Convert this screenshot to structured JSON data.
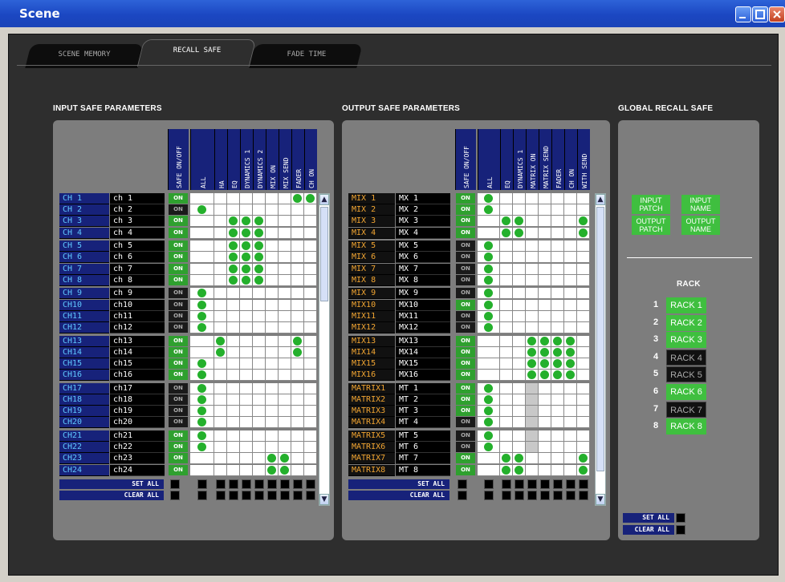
{
  "window": {
    "title": "Scene"
  },
  "tabs": [
    "SCENE MEMORY",
    "RECALL SAFE",
    "FADE TIME"
  ],
  "active_tab": 1,
  "sections": {
    "input": "INPUT SAFE PARAMETERS",
    "output": "OUTPUT SAFE PARAMETERS",
    "global": "GLOBAL RECALL SAFE"
  },
  "input_columns": [
    "SAFE ON/OFF",
    "ALL",
    "HA",
    "EQ",
    "DYNAMICS 1",
    "DYNAMICS 2",
    "MIX ON",
    "MIX SEND",
    "FADER",
    "CH ON"
  ],
  "input_rows": [
    {
      "label": "CH 1",
      "name": "ch 1",
      "on": true,
      "dots": [
        0,
        0,
        0,
        0,
        0,
        0,
        0,
        1,
        1
      ]
    },
    {
      "label": "CH 2",
      "name": "ch 2",
      "on": false,
      "dots": [
        1,
        0,
        0,
        0,
        0,
        0,
        0,
        0,
        0
      ]
    },
    {
      "label": "CH 3",
      "name": "ch 3",
      "on": true,
      "dots": [
        0,
        0,
        1,
        1,
        1,
        0,
        0,
        0,
        0
      ]
    },
    {
      "label": "CH 4",
      "name": "ch 4",
      "on": true,
      "dots": [
        0,
        0,
        1,
        1,
        1,
        0,
        0,
        0,
        0
      ]
    },
    {
      "label": "CH 5",
      "name": "ch 5",
      "on": true,
      "dots": [
        0,
        0,
        1,
        1,
        1,
        0,
        0,
        0,
        0
      ]
    },
    {
      "label": "CH 6",
      "name": "ch 6",
      "on": true,
      "dots": [
        0,
        0,
        1,
        1,
        1,
        0,
        0,
        0,
        0
      ]
    },
    {
      "label": "CH 7",
      "name": "ch 7",
      "on": true,
      "dots": [
        0,
        0,
        1,
        1,
        1,
        0,
        0,
        0,
        0
      ]
    },
    {
      "label": "CH 8",
      "name": "ch 8",
      "on": true,
      "dots": [
        0,
        0,
        1,
        1,
        1,
        0,
        0,
        0,
        0
      ]
    },
    {
      "label": "CH 9",
      "name": "ch 9",
      "on": false,
      "dots": [
        1,
        0,
        0,
        0,
        0,
        0,
        0,
        0,
        0
      ]
    },
    {
      "label": "CH10",
      "name": "ch10",
      "on": false,
      "dots": [
        1,
        0,
        0,
        0,
        0,
        0,
        0,
        0,
        0
      ]
    },
    {
      "label": "CH11",
      "name": "ch11",
      "on": false,
      "dots": [
        1,
        0,
        0,
        0,
        0,
        0,
        0,
        0,
        0
      ]
    },
    {
      "label": "CH12",
      "name": "ch12",
      "on": false,
      "dots": [
        1,
        0,
        0,
        0,
        0,
        0,
        0,
        0,
        0
      ]
    },
    {
      "label": "CH13",
      "name": "ch13",
      "on": true,
      "dots": [
        0,
        1,
        0,
        0,
        0,
        0,
        0,
        1,
        0
      ]
    },
    {
      "label": "CH14",
      "name": "ch14",
      "on": true,
      "dots": [
        0,
        1,
        0,
        0,
        0,
        0,
        0,
        1,
        0
      ]
    },
    {
      "label": "CH15",
      "name": "ch15",
      "on": true,
      "dots": [
        1,
        0,
        0,
        0,
        0,
        0,
        0,
        0,
        0
      ]
    },
    {
      "label": "CH16",
      "name": "ch16",
      "on": true,
      "dots": [
        1,
        0,
        0,
        0,
        0,
        0,
        0,
        0,
        0
      ]
    },
    {
      "label": "CH17",
      "name": "ch17",
      "on": false,
      "dots": [
        1,
        0,
        0,
        0,
        0,
        0,
        0,
        0,
        0
      ]
    },
    {
      "label": "CH18",
      "name": "ch18",
      "on": false,
      "dots": [
        1,
        0,
        0,
        0,
        0,
        0,
        0,
        0,
        0
      ]
    },
    {
      "label": "CH19",
      "name": "ch19",
      "on": false,
      "dots": [
        1,
        0,
        0,
        0,
        0,
        0,
        0,
        0,
        0
      ]
    },
    {
      "label": "CH20",
      "name": "ch20",
      "on": false,
      "dots": [
        1,
        0,
        0,
        0,
        0,
        0,
        0,
        0,
        0
      ]
    },
    {
      "label": "CH21",
      "name": "ch21",
      "on": true,
      "dots": [
        1,
        0,
        0,
        0,
        0,
        0,
        0,
        0,
        0
      ]
    },
    {
      "label": "CH22",
      "name": "ch22",
      "on": true,
      "dots": [
        1,
        0,
        0,
        0,
        0,
        0,
        0,
        0,
        0
      ]
    },
    {
      "label": "CH23",
      "name": "ch23",
      "on": true,
      "dots": [
        0,
        0,
        0,
        0,
        0,
        1,
        1,
        0,
        0
      ]
    },
    {
      "label": "CH24",
      "name": "ch24",
      "on": true,
      "dots": [
        0,
        0,
        0,
        0,
        0,
        1,
        1,
        0,
        0
      ]
    }
  ],
  "output_columns": [
    "SAFE ON/OFF",
    "ALL",
    "EQ",
    "DYNAMICS 1",
    "MATRIX ON",
    "MATRIX SEND",
    "FADER",
    "CH ON",
    "WITH SEND"
  ],
  "output_rows": [
    {
      "label": "MIX 1",
      "name": "MX 1",
      "on": true,
      "dots": [
        1,
        0,
        0,
        0,
        0,
        0,
        0,
        0
      ]
    },
    {
      "label": "MIX 2",
      "name": "MX 2",
      "on": true,
      "dots": [
        1,
        0,
        0,
        0,
        0,
        0,
        0,
        0
      ]
    },
    {
      "label": "MIX 3",
      "name": "MX 3",
      "on": true,
      "dots": [
        0,
        1,
        1,
        0,
        0,
        0,
        0,
        1
      ]
    },
    {
      "label": "MIX 4",
      "name": "MX 4",
      "on": true,
      "dots": [
        0,
        1,
        1,
        0,
        0,
        0,
        0,
        1
      ]
    },
    {
      "label": "MIX 5",
      "name": "MX 5",
      "on": false,
      "dots": [
        1,
        0,
        0,
        0,
        0,
        0,
        0,
        0
      ]
    },
    {
      "label": "MIX 6",
      "name": "MX 6",
      "on": false,
      "dots": [
        1,
        0,
        0,
        0,
        0,
        0,
        0,
        0
      ]
    },
    {
      "label": "MIX 7",
      "name": "MX 7",
      "on": false,
      "dots": [
        1,
        0,
        0,
        0,
        0,
        0,
        0,
        0
      ]
    },
    {
      "label": "MIX 8",
      "name": "MX 8",
      "on": false,
      "dots": [
        1,
        0,
        0,
        0,
        0,
        0,
        0,
        0
      ]
    },
    {
      "label": "MIX 9",
      "name": "MX 9",
      "on": false,
      "dots": [
        1,
        0,
        0,
        0,
        0,
        0,
        0,
        0
      ]
    },
    {
      "label": "MIX10",
      "name": "MX10",
      "on": true,
      "dots": [
        1,
        0,
        0,
        0,
        0,
        0,
        0,
        0
      ]
    },
    {
      "label": "MIX11",
      "name": "MX11",
      "on": false,
      "dots": [
        1,
        0,
        0,
        0,
        0,
        0,
        0,
        0
      ]
    },
    {
      "label": "MIX12",
      "name": "MX12",
      "on": false,
      "dots": [
        1,
        0,
        0,
        0,
        0,
        0,
        0,
        0
      ]
    },
    {
      "label": "MIX13",
      "name": "MX13",
      "on": true,
      "dots": [
        0,
        0,
        0,
        1,
        1,
        1,
        1,
        0
      ]
    },
    {
      "label": "MIX14",
      "name": "MX14",
      "on": true,
      "dots": [
        0,
        0,
        0,
        1,
        1,
        1,
        1,
        0
      ]
    },
    {
      "label": "MIX15",
      "name": "MX15",
      "on": true,
      "dots": [
        0,
        0,
        0,
        1,
        1,
        1,
        1,
        0
      ]
    },
    {
      "label": "MIX16",
      "name": "MX16",
      "on": true,
      "dots": [
        0,
        0,
        0,
        1,
        1,
        1,
        1,
        0
      ]
    },
    {
      "label": "MATRIX1",
      "name": "MT 1",
      "on": true,
      "dots": [
        1,
        0,
        0,
        0,
        0,
        0,
        0,
        0
      ]
    },
    {
      "label": "MATRIX2",
      "name": "MT 2",
      "on": true,
      "dots": [
        1,
        0,
        0,
        0,
        0,
        0,
        0,
        0
      ]
    },
    {
      "label": "MATRIX3",
      "name": "MT 3",
      "on": true,
      "dots": [
        1,
        0,
        0,
        0,
        0,
        0,
        0,
        0
      ]
    },
    {
      "label": "MATRIX4",
      "name": "MT 4",
      "on": false,
      "dots": [
        1,
        0,
        0,
        0,
        0,
        0,
        0,
        0
      ]
    },
    {
      "label": "MATRIX5",
      "name": "MT 5",
      "on": false,
      "dots": [
        1,
        0,
        0,
        0,
        0,
        0,
        0,
        0
      ]
    },
    {
      "label": "MATRIX6",
      "name": "MT 6",
      "on": false,
      "dots": [
        1,
        0,
        0,
        0,
        0,
        0,
        0,
        0
      ]
    },
    {
      "label": "MATRIX7",
      "name": "MT 7",
      "on": true,
      "dots": [
        0,
        1,
        1,
        0,
        0,
        0,
        0,
        1
      ]
    },
    {
      "label": "MATRIX8",
      "name": "MT 8",
      "on": true,
      "dots": [
        0,
        1,
        1,
        0,
        0,
        0,
        0,
        1
      ]
    }
  ],
  "set_all": "SET ALL",
  "clear_all": "CLEAR ALL",
  "global_buttons": [
    [
      "INPUT",
      "PATCH"
    ],
    [
      "INPUT",
      "NAME"
    ],
    [
      "OUTPUT",
      "PATCH"
    ],
    [
      "OUTPUT",
      "NAME"
    ]
  ],
  "rack_title": "RACK",
  "racks": [
    {
      "num": "1",
      "label": "RACK 1",
      "on": true
    },
    {
      "num": "2",
      "label": "RACK 2",
      "on": true
    },
    {
      "num": "3",
      "label": "RACK 3",
      "on": true
    },
    {
      "num": "4",
      "label": "RACK 4",
      "on": false
    },
    {
      "num": "5",
      "label": "RACK 5",
      "on": false
    },
    {
      "num": "6",
      "label": "RACK 6",
      "on": true
    },
    {
      "num": "7",
      "label": "RACK 7",
      "on": false
    },
    {
      "num": "8",
      "label": "RACK 8",
      "on": true
    }
  ]
}
